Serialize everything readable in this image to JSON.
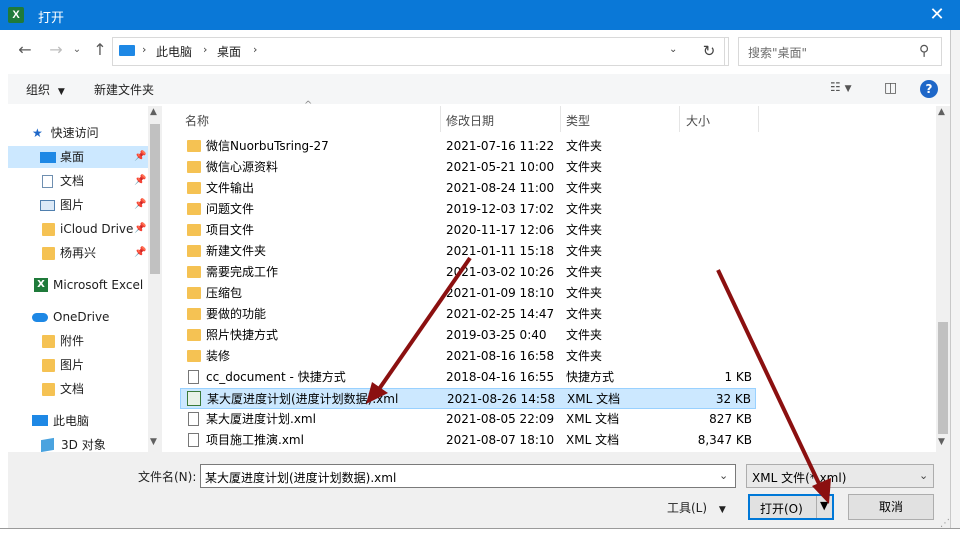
{
  "window": {
    "title": "打开",
    "app_icon": "excel-icon"
  },
  "address_bar": {
    "segments": [
      "此电脑",
      "桌面"
    ]
  },
  "search": {
    "placeholder": "搜索\"桌面\""
  },
  "toolbar": {
    "organize": "组织",
    "new_folder": "新建文件夹"
  },
  "nav": {
    "items": [
      {
        "label": "快速访问",
        "icon": "star-icon"
      },
      {
        "label": "桌面",
        "icon": "desktop-icon",
        "pinned": true,
        "selected": true
      },
      {
        "label": "文档",
        "icon": "document-icon",
        "pinned": true
      },
      {
        "label": "图片",
        "icon": "picture-icon",
        "pinned": true
      },
      {
        "label": "iCloud Drive",
        "icon": "folder-icon",
        "pinned": true
      },
      {
        "label": "杨再兴",
        "icon": "folder-icon",
        "pinned": true
      },
      {
        "label": "Microsoft Excel",
        "icon": "excel-icon"
      },
      {
        "label": "OneDrive",
        "icon": "cloud-icon"
      },
      {
        "label": "附件",
        "icon": "folder-icon"
      },
      {
        "label": "图片",
        "icon": "folder-icon"
      },
      {
        "label": "文档",
        "icon": "folder-icon"
      },
      {
        "label": "此电脑",
        "icon": "computer-icon"
      },
      {
        "label": "3D 对象",
        "icon": "cube-icon"
      }
    ]
  },
  "columns": {
    "name": "名称",
    "date": "修改日期",
    "type": "类型",
    "size": "大小"
  },
  "files": [
    {
      "name": "微信NuorbuTsring-27",
      "date": "2021-07-16 11:22",
      "type": "文件夹",
      "size": "",
      "icon": "folder"
    },
    {
      "name": "微信心源资料",
      "date": "2021-05-21 10:00",
      "type": "文件夹",
      "size": "",
      "icon": "folder"
    },
    {
      "name": "文件输出",
      "date": "2021-08-24 11:00",
      "type": "文件夹",
      "size": "",
      "icon": "folder"
    },
    {
      "name": "问题文件",
      "date": "2019-12-03 17:02",
      "type": "文件夹",
      "size": "",
      "icon": "folder"
    },
    {
      "name": "项目文件",
      "date": "2020-11-17 12:06",
      "type": "文件夹",
      "size": "",
      "icon": "folder"
    },
    {
      "name": "新建文件夹",
      "date": "2021-01-11 15:18",
      "type": "文件夹",
      "size": "",
      "icon": "folder"
    },
    {
      "name": "需要完成工作",
      "date": "2021-03-02 10:26",
      "type": "文件夹",
      "size": "",
      "icon": "folder"
    },
    {
      "name": "压缩包",
      "date": "2021-01-09 18:10",
      "type": "文件夹",
      "size": "",
      "icon": "folder"
    },
    {
      "name": "要做的功能",
      "date": "2021-02-25 14:47",
      "type": "文件夹",
      "size": "",
      "icon": "folder"
    },
    {
      "name": "照片快捷方式",
      "date": "2019-03-25 0:40",
      "type": "文件夹",
      "size": "",
      "icon": "folder"
    },
    {
      "name": "装修",
      "date": "2021-08-16 16:58",
      "type": "文件夹",
      "size": "",
      "icon": "folder"
    },
    {
      "name": "cc_document - 快捷方式",
      "date": "2018-04-16 16:55",
      "type": "快捷方式",
      "size": "1 KB",
      "icon": "doc"
    },
    {
      "name": "某大厦进度计划(进度计划数据).xml",
      "date": "2021-08-26 14:58",
      "type": "XML 文档",
      "size": "32 KB",
      "icon": "xml",
      "selected": true
    },
    {
      "name": "某大厦进度计划.xml",
      "date": "2021-08-05 22:09",
      "type": "XML 文档",
      "size": "827 KB",
      "icon": "doc"
    },
    {
      "name": "项目施工推演.xml",
      "date": "2021-08-07 18:10",
      "type": "XML 文档",
      "size": "8,347 KB",
      "icon": "doc"
    }
  ],
  "footer": {
    "filename_label": "文件名(N):",
    "filename_value": "某大厦进度计划(进度计划数据).xml",
    "filetype_value": "XML 文件(*.xml)",
    "tools_label": "工具(L)",
    "open_label": "打开(O)",
    "cancel_label": "取消"
  },
  "colors": {
    "titlebar": "#0a78d7",
    "selection": "#cce8ff",
    "annotation_arrow": "#8b1010"
  }
}
